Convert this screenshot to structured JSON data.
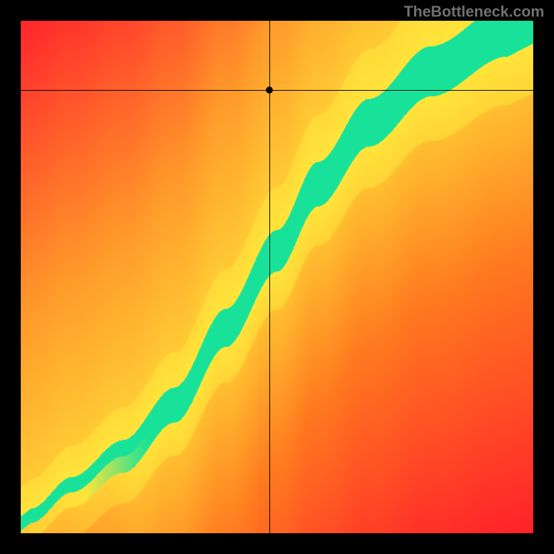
{
  "watermark": "TheBottleneck.com",
  "chart_data": {
    "type": "heatmap",
    "title": "",
    "xlabel": "",
    "ylabel": "",
    "xlim": [
      0,
      1
    ],
    "ylim": [
      0,
      1
    ],
    "crosshair": {
      "x": 0.485,
      "y": 0.865
    },
    "marker": {
      "x": 0.485,
      "y": 0.865
    },
    "colorscale": {
      "description": "red (low/mismatch) → orange → yellow → green (optimal match) → yellow → orange → red",
      "stops": [
        {
          "v": 0.0,
          "color": "#ff1a2b"
        },
        {
          "v": 0.25,
          "color": "#ff7a1f"
        },
        {
          "v": 0.45,
          "color": "#ffe43a"
        },
        {
          "v": 0.5,
          "color": "#18e29a"
        },
        {
          "v": 0.55,
          "color": "#ffe43a"
        },
        {
          "v": 0.75,
          "color": "#ff9a2a"
        },
        {
          "v": 1.0,
          "color": "#ff1a2b"
        }
      ]
    },
    "ridge": {
      "description": "green optimal band roughly along a curve from lower-left upward with increasing slope",
      "points": [
        {
          "x": 0.02,
          "y": 0.02
        },
        {
          "x": 0.1,
          "y": 0.08
        },
        {
          "x": 0.2,
          "y": 0.15
        },
        {
          "x": 0.3,
          "y": 0.25
        },
        {
          "x": 0.4,
          "y": 0.4
        },
        {
          "x": 0.5,
          "y": 0.55
        },
        {
          "x": 0.58,
          "y": 0.68
        },
        {
          "x": 0.68,
          "y": 0.8
        },
        {
          "x": 0.8,
          "y": 0.9
        },
        {
          "x": 0.95,
          "y": 0.98
        }
      ],
      "band_width": 0.06
    }
  }
}
